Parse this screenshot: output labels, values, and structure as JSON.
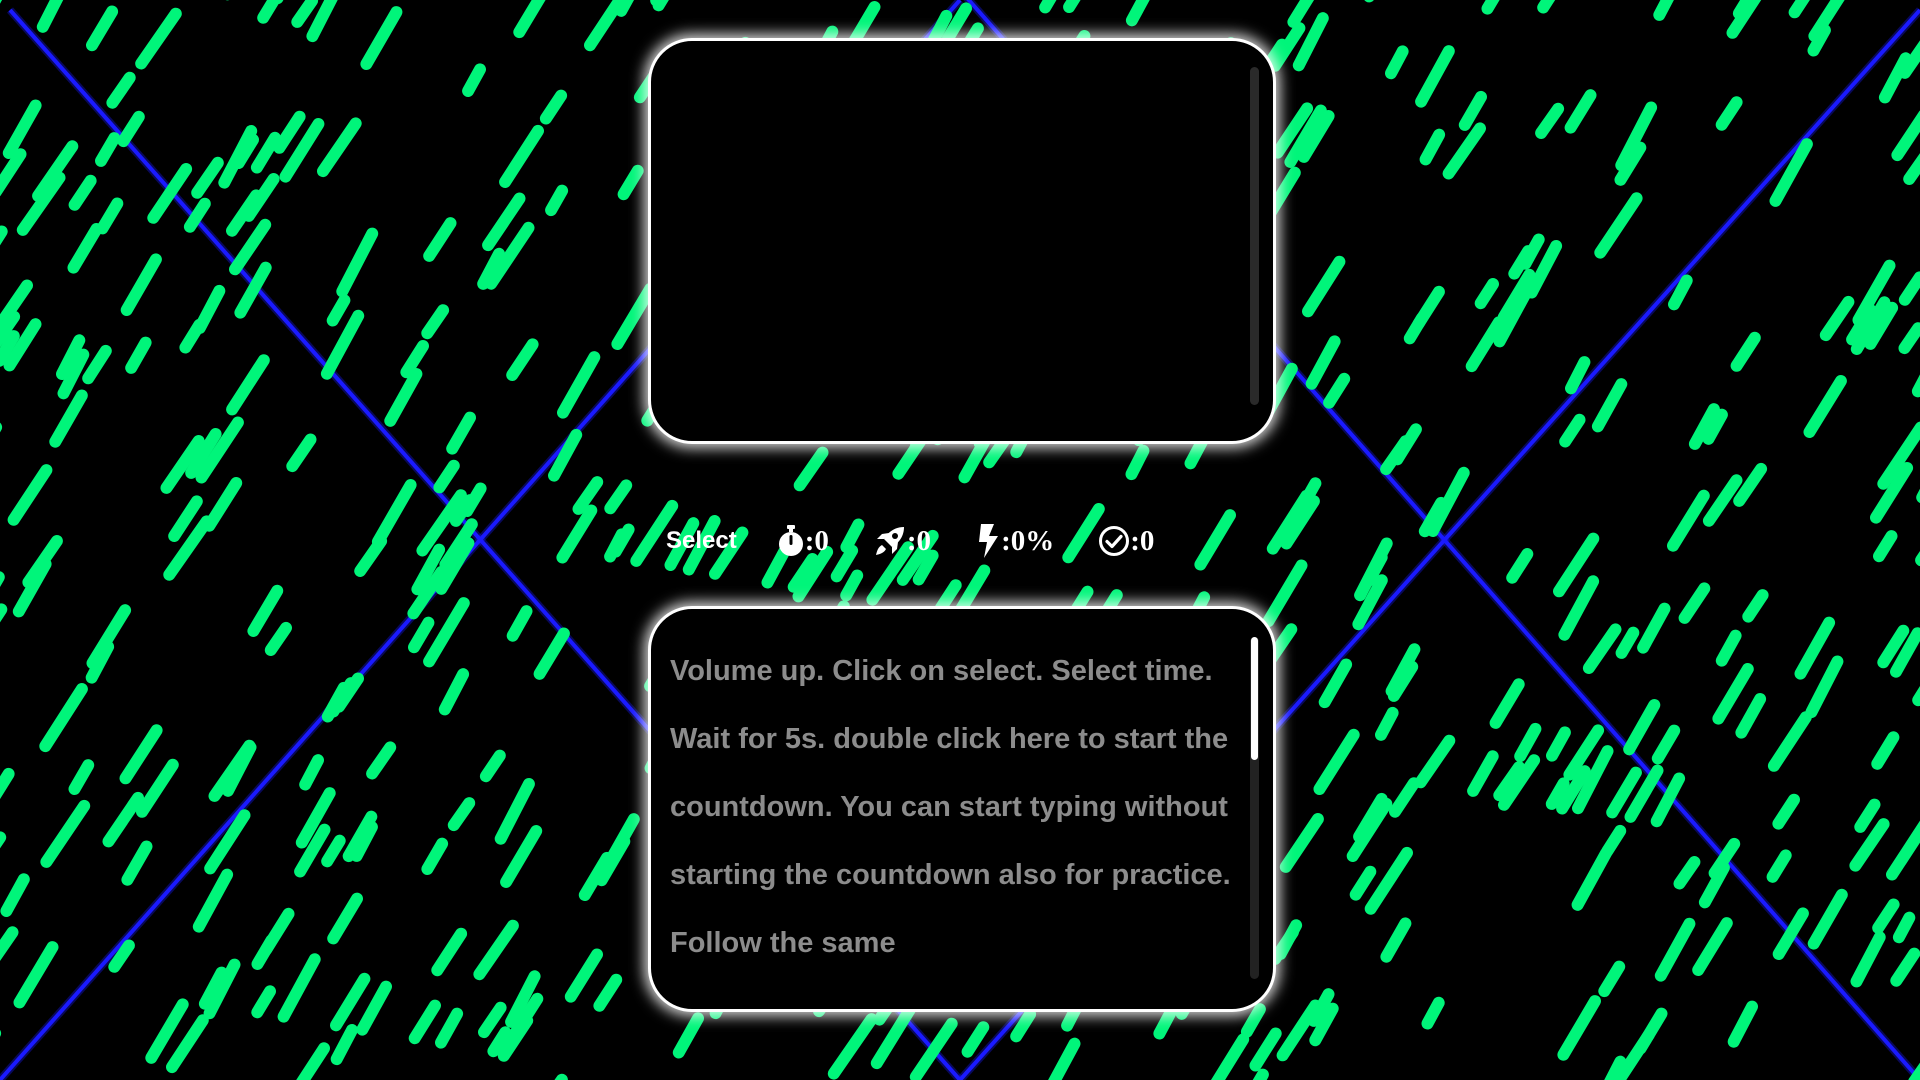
{
  "colors": {
    "background": "#000000",
    "rain": "#00f57a",
    "laser": "#1a1aff",
    "panel_border": "#ffffff",
    "placeholder_text": "#8c8c8c"
  },
  "display_panel": {
    "text": ""
  },
  "stats": {
    "select_label": "Select",
    "time": {
      "icon": "stopwatch-icon",
      "value": ":0"
    },
    "speed": {
      "icon": "rocket-icon",
      "value": ":0"
    },
    "accuracy": {
      "icon": "lightning-icon",
      "value": ":0%"
    },
    "correct": {
      "icon": "check-circle-icon",
      "value": ":0"
    }
  },
  "input_panel": {
    "placeholder": "Volume up. Click on select. Select time. Wait for 5s. double click here to start the countdown. You can start typing without starting the countdown also for practice. Follow the same",
    "scroll_fraction": 0.36
  }
}
